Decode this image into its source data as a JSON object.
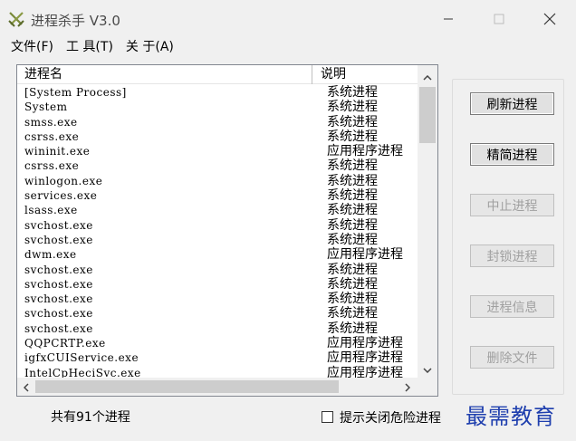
{
  "window": {
    "title": "进程杀手 V3.0",
    "icon": "crossed-swords-icon",
    "controls": [
      "minimize-icon",
      "maximize-icon",
      "close-icon"
    ]
  },
  "menu": {
    "items": [
      {
        "label": "文件(F)"
      },
      {
        "label": "工 具(T)"
      },
      {
        "label": "关 于(A)"
      }
    ]
  },
  "process_list": {
    "columns": [
      "进程名",
      "说明"
    ],
    "rows": [
      {
        "name": "[System Process]",
        "desc": "系统进程"
      },
      {
        "name": "System",
        "desc": "系统进程"
      },
      {
        "name": "smss.exe",
        "desc": "系统进程"
      },
      {
        "name": "csrss.exe",
        "desc": "系统进程"
      },
      {
        "name": "wininit.exe",
        "desc": "应用程序进程"
      },
      {
        "name": "csrss.exe",
        "desc": "系统进程"
      },
      {
        "name": "winlogon.exe",
        "desc": "系统进程"
      },
      {
        "name": "services.exe",
        "desc": "系统进程"
      },
      {
        "name": "lsass.exe",
        "desc": "系统进程"
      },
      {
        "name": "svchost.exe",
        "desc": "系统进程"
      },
      {
        "name": "svchost.exe",
        "desc": "系统进程"
      },
      {
        "name": "dwm.exe",
        "desc": "应用程序进程"
      },
      {
        "name": "svchost.exe",
        "desc": "系统进程"
      },
      {
        "name": "svchost.exe",
        "desc": "系统进程"
      },
      {
        "name": "svchost.exe",
        "desc": "系统进程"
      },
      {
        "name": "svchost.exe",
        "desc": "系统进程"
      },
      {
        "name": "svchost.exe",
        "desc": "系统进程"
      },
      {
        "name": "QQPCRTP.exe",
        "desc": "应用程序进程"
      },
      {
        "name": "igfxCUIService.exe",
        "desc": "应用程序进程"
      },
      {
        "name": "IntelCpHeciSvc.exe",
        "desc": "应用程序进程"
      }
    ]
  },
  "actions": [
    {
      "label": "刷新进程",
      "enabled": true
    },
    {
      "label": "精简进程",
      "enabled": true
    },
    {
      "label": "中止进程",
      "enabled": false
    },
    {
      "label": "封锁进程",
      "enabled": false
    },
    {
      "label": "进程信息",
      "enabled": false
    },
    {
      "label": "删除文件",
      "enabled": false
    }
  ],
  "status": {
    "count_text": "共有91个进程"
  },
  "option": {
    "label": "提示关闭危险进程",
    "checked": false
  },
  "watermark": "最需教育",
  "colors": {
    "watermark": "#1f3fae",
    "disabled_text": "#a0a0a0"
  }
}
